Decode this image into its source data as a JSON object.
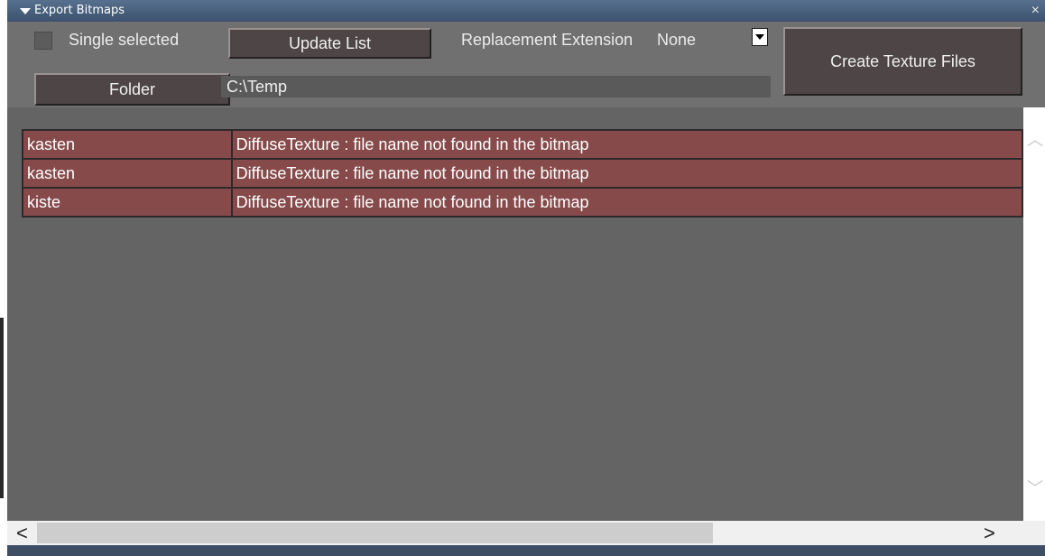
{
  "window": {
    "title": "Export Bitmaps",
    "close_glyph": "×"
  },
  "toolbar": {
    "single_selected_label": "Single selected",
    "single_selected_checked": false,
    "update_list_label": "Update List",
    "replacement_extension_label": "Replacement Extension",
    "replacement_extension_value": "None",
    "create_texture_files_label": "Create Texture Files",
    "folder_label": "Folder",
    "folder_path": "C:\\Temp"
  },
  "list": {
    "rows": [
      {
        "name": "kasten",
        "message": "DiffuseTexture : file name not found in the bitmap"
      },
      {
        "name": "kasten",
        "message": "DiffuseTexture : file name not found in the bitmap"
      },
      {
        "name": "kiste",
        "message": "DiffuseTexture : file name not found in the bitmap"
      }
    ]
  },
  "scrollbars": {
    "left_arrow": "<",
    "right_arrow": ">",
    "up_arrow": "︿",
    "down_arrow": "﹀"
  },
  "colors": {
    "error_row": "#864a4b",
    "panel_bg": "#646464",
    "titlebar": "#4a6180"
  }
}
